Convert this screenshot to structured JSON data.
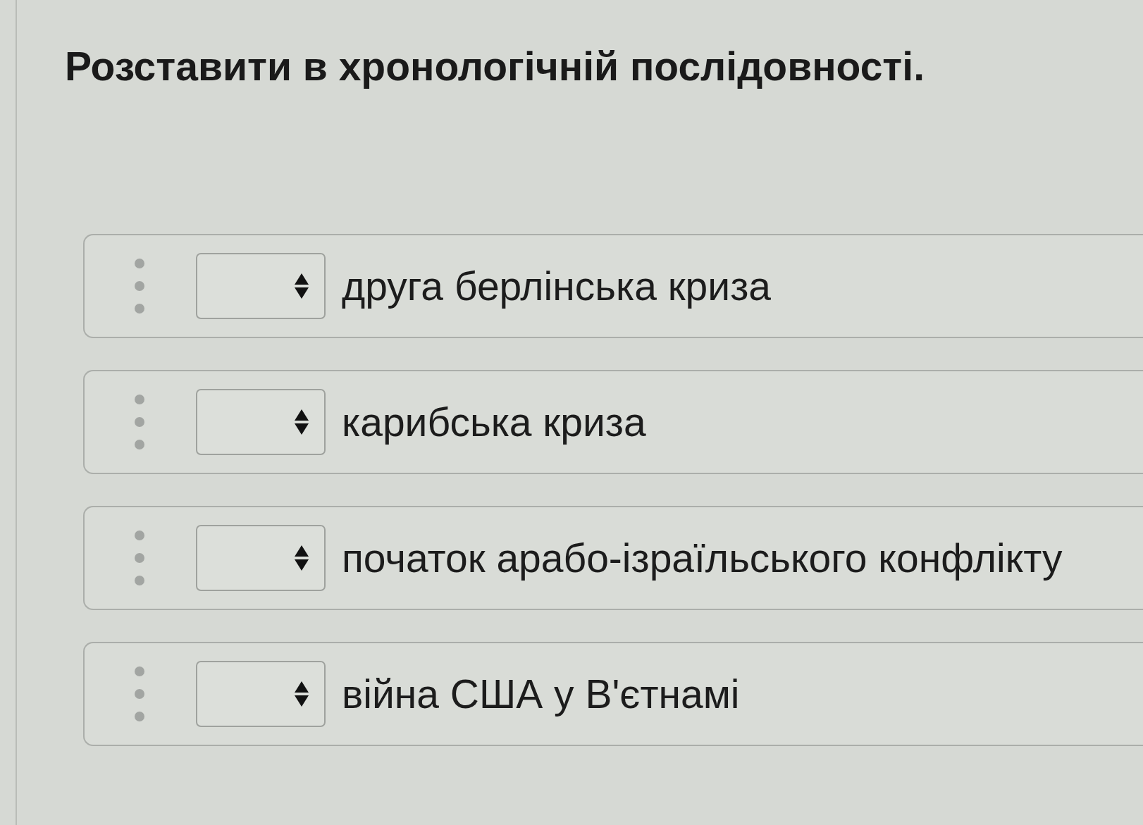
{
  "question": {
    "title": "Розставити в хронологічній послідовності."
  },
  "items": [
    {
      "label": "друга берлінська криза"
    },
    {
      "label": "карибська криза"
    },
    {
      "label": "початок арабо-ізраїльського конфлікту"
    },
    {
      "label": "війна США у В'єтнамі"
    }
  ]
}
